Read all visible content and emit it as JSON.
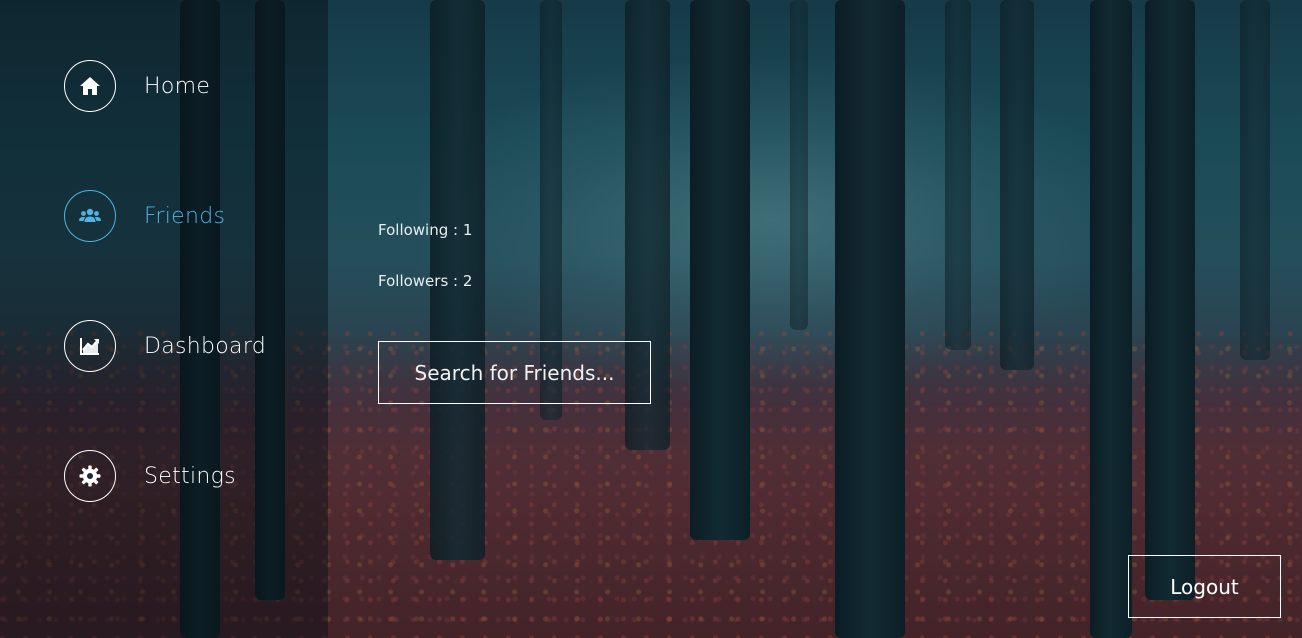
{
  "nav": {
    "items": [
      {
        "label": "Home",
        "icon": "home-icon",
        "active": false
      },
      {
        "label": "Friends",
        "icon": "users-icon",
        "active": true
      },
      {
        "label": "Dashboard",
        "icon": "chart-line-icon",
        "active": false
      },
      {
        "label": "Settings",
        "icon": "gear-icon",
        "active": false
      }
    ],
    "active_color": "#4fb3e3"
  },
  "stats": {
    "following": "Following : 1",
    "followers": "Followers : 2"
  },
  "search": {
    "placeholder": "Search for Friends..."
  },
  "logout": {
    "label": "Logout"
  }
}
